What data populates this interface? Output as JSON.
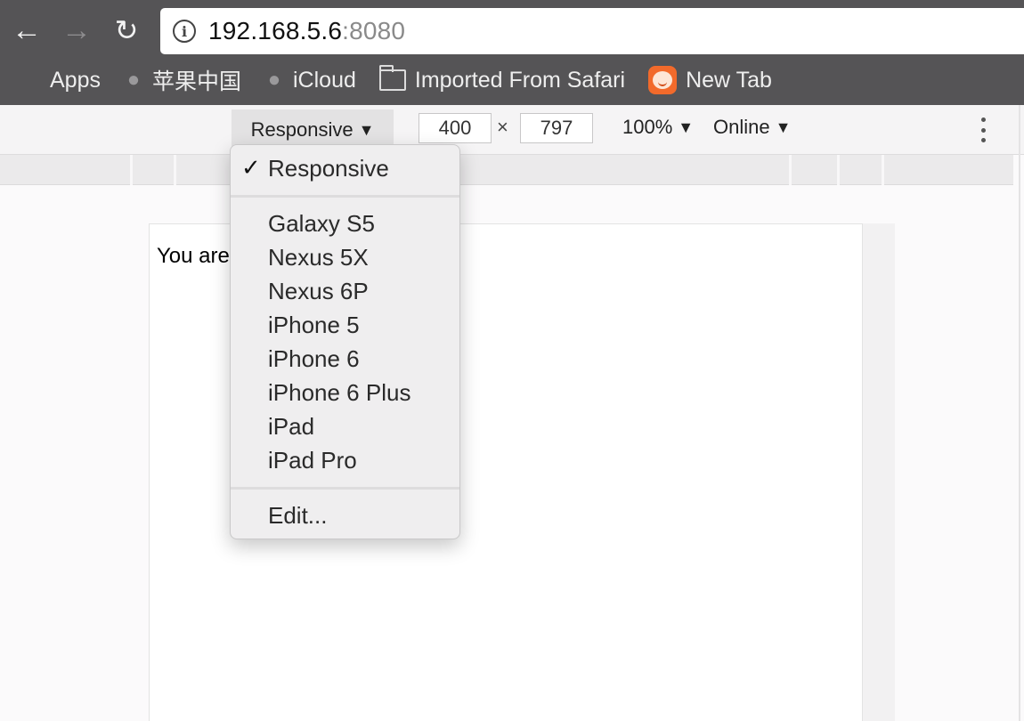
{
  "browser": {
    "url_host": "192.168.5.6",
    "url_port": ":8080",
    "bookmarks": [
      {
        "label": "Apps",
        "icon": "apps-grid-icon"
      },
      {
        "label": "苹果中国",
        "icon": "apple-icon"
      },
      {
        "label": "iCloud",
        "icon": "apple-icon"
      },
      {
        "label": "Imported From Safari",
        "icon": "folder-icon"
      },
      {
        "label": "New Tab",
        "icon": "new-tab-favicon"
      }
    ]
  },
  "device_toolbar": {
    "device": "Responsive",
    "width": "400",
    "height": "797",
    "times": "×",
    "zoom": "100%",
    "network": "Online",
    "caret": "▼"
  },
  "page": {
    "text": "You are using the application"
  },
  "dropdown": {
    "check": "✓",
    "selected": "Responsive",
    "devices": [
      "Galaxy S5",
      "Nexus 5X",
      "Nexus 6P",
      "iPhone 5",
      "iPhone 6",
      "iPhone 6 Plus",
      "iPad",
      "iPad Pro"
    ],
    "edit": "Edit..."
  },
  "colors": {
    "chrome_bar": "#555456",
    "toolbar": "#f5f4f5",
    "menu": "#efeeef"
  }
}
